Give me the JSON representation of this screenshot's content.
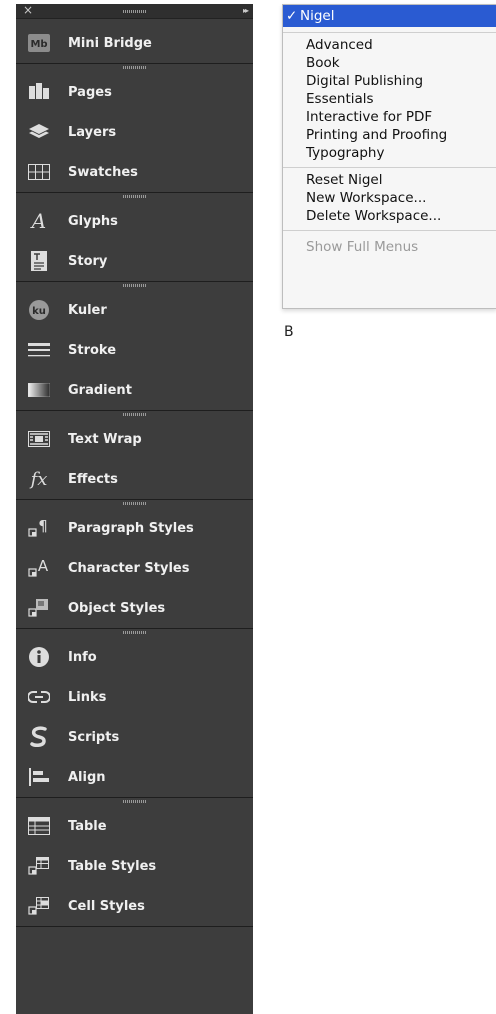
{
  "panel": {
    "close_glyph": "×",
    "collapse_glyph": "▸▸",
    "groups": [
      {
        "items": [
          {
            "label": "Mini Bridge",
            "icon": "mini-bridge-icon"
          }
        ]
      },
      {
        "items": [
          {
            "label": "Pages",
            "icon": "pages-icon"
          },
          {
            "label": "Layers",
            "icon": "layers-icon"
          },
          {
            "label": "Swatches",
            "icon": "swatches-icon"
          }
        ]
      },
      {
        "items": [
          {
            "label": "Glyphs",
            "icon": "glyphs-icon"
          },
          {
            "label": "Story",
            "icon": "story-icon"
          }
        ]
      },
      {
        "items": [
          {
            "label": "Kuler",
            "icon": "kuler-icon"
          },
          {
            "label": "Stroke",
            "icon": "stroke-icon"
          },
          {
            "label": "Gradient",
            "icon": "gradient-icon"
          }
        ]
      },
      {
        "items": [
          {
            "label": "Text Wrap",
            "icon": "text-wrap-icon"
          },
          {
            "label": "Effects",
            "icon": "effects-icon"
          }
        ]
      },
      {
        "items": [
          {
            "label": "Paragraph Styles",
            "icon": "paragraph-styles-icon"
          },
          {
            "label": "Character Styles",
            "icon": "character-styles-icon"
          },
          {
            "label": "Object Styles",
            "icon": "object-styles-icon"
          }
        ]
      },
      {
        "items": [
          {
            "label": "Info",
            "icon": "info-icon"
          },
          {
            "label": "Links",
            "icon": "links-icon"
          },
          {
            "label": "Scripts",
            "icon": "scripts-icon"
          },
          {
            "label": "Align",
            "icon": "align-icon"
          }
        ]
      },
      {
        "items": [
          {
            "label": "Table",
            "icon": "table-icon"
          },
          {
            "label": "Table Styles",
            "icon": "table-styles-icon"
          },
          {
            "label": "Cell Styles",
            "icon": "cell-styles-icon"
          }
        ]
      }
    ]
  },
  "menu": {
    "selected": {
      "check": "✓",
      "label": "Nigel"
    },
    "workspaces": [
      "Advanced",
      "Book",
      "Digital Publishing",
      "Essentials",
      "Interactive for PDF",
      "Printing and Proofing",
      "Typography"
    ],
    "actions": [
      "Reset Nigel",
      "New Workspace...",
      "Delete Workspace..."
    ],
    "footer": "Show Full Menus"
  },
  "figure_label": "B",
  "colors": {
    "panel_bg": "#3d3d3d",
    "menu_highlight": "#2a5bd2"
  }
}
